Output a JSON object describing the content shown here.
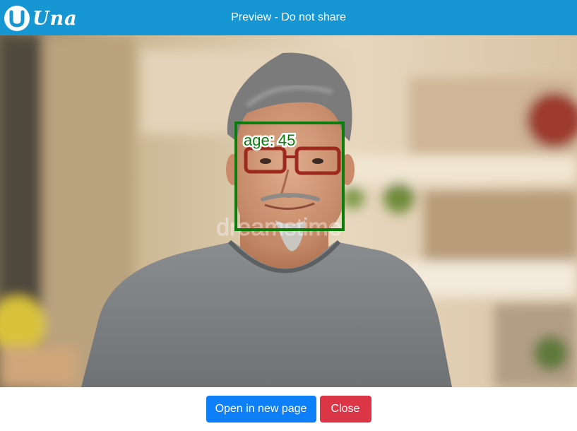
{
  "header": {
    "logo_text": "Una",
    "title": "Preview - Do not share"
  },
  "preview": {
    "detection_label": "age: 45",
    "watermark_text": "dreamstime"
  },
  "footer": {
    "open_label": "Open in new page",
    "close_label": "Close"
  },
  "colors": {
    "header": "#1696d3",
    "primary": "#0d7ff8",
    "danger": "#dc3545",
    "detection_box": "#0a7d0a"
  }
}
